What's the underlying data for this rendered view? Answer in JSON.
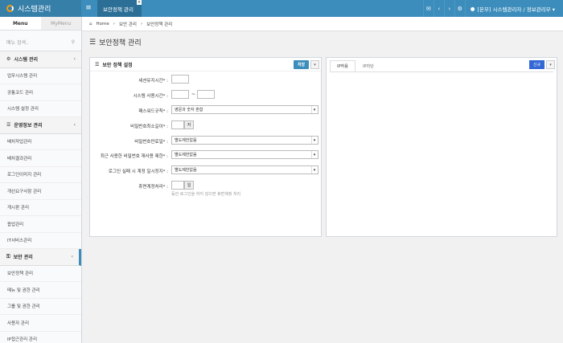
{
  "header": {
    "app_title": "시스템관리",
    "open_tab": "보안정책 관리",
    "tab_close": "×",
    "user": "[본부] 시스템관리자 / 정보관리부 ▾"
  },
  "sidebar": {
    "tabs": [
      "Menu",
      "MyMenu"
    ],
    "search_placeholder": "메뉴 검색..",
    "items": [
      {
        "type": "group",
        "label": "시스템 관리",
        "icon": "gear-icon"
      },
      {
        "type": "item",
        "label": "업무시스템 관리"
      },
      {
        "type": "item",
        "label": "공통코드 관리"
      },
      {
        "type": "item",
        "label": "시스템 설정 관리"
      },
      {
        "type": "group",
        "label": "운영정보 관리",
        "icon": "list-icon"
      },
      {
        "type": "item",
        "label": "배치작업관리"
      },
      {
        "type": "item",
        "label": "배치결과관리"
      },
      {
        "type": "item",
        "label": "로그인이미지 관리"
      },
      {
        "type": "item",
        "label": "개선요구사항 관리"
      },
      {
        "type": "item",
        "label": "게시판 관리"
      },
      {
        "type": "item",
        "label": "팝업관리"
      },
      {
        "type": "item",
        "label": "IT서비스관리"
      },
      {
        "type": "group",
        "label": "보안 관리",
        "icon": "lock-icon",
        "active": true
      },
      {
        "type": "item",
        "label": "보안정책 관리"
      },
      {
        "type": "item",
        "label": "메뉴 및 권한 관리"
      },
      {
        "type": "item",
        "label": "그룹 및 권한 관리"
      },
      {
        "type": "item",
        "label": "사용자 관리"
      },
      {
        "type": "item",
        "label": "IP접근관리 관리"
      }
    ]
  },
  "breadcrumb": [
    "Home",
    "보안 관리",
    "보안정책 관리"
  ],
  "page_title": "보안정책 관리",
  "settings_box": {
    "title": "보안 정책 설정",
    "save_label": "저장",
    "fields": {
      "session_timeout": {
        "label": "세션유지시간* :",
        "value": ""
      },
      "system_hours": {
        "label": "시스템 사용시간* :",
        "from": "",
        "to": "",
        "dash": "~"
      },
      "password_rule": {
        "label": "패스워드규칙* :",
        "value": "영문과 숫자 혼합"
      },
      "password_min_len": {
        "label": "비밀번호최소길이* :",
        "value": "",
        "unit": "자"
      },
      "password_expiry": {
        "label": "비밀번호만료일* :",
        "value": "별도제한없음"
      },
      "password_reuse": {
        "label": "최근 사용한 비밀번호 재사용 제한* :",
        "value": "별도제한없음"
      },
      "login_lock": {
        "label": "로그인 실패 시 계정 일시정지* :",
        "value": "별도제한없음"
      },
      "dormant": {
        "label": "휴면계정처리* :",
        "value": "",
        "unit": "일",
        "help": "동안 로그인을 하지 않으면 휴면계정 처리"
      }
    }
  },
  "ip_box": {
    "tabs": [
      "IP허용",
      "IP차단"
    ],
    "new_label": "신규"
  }
}
